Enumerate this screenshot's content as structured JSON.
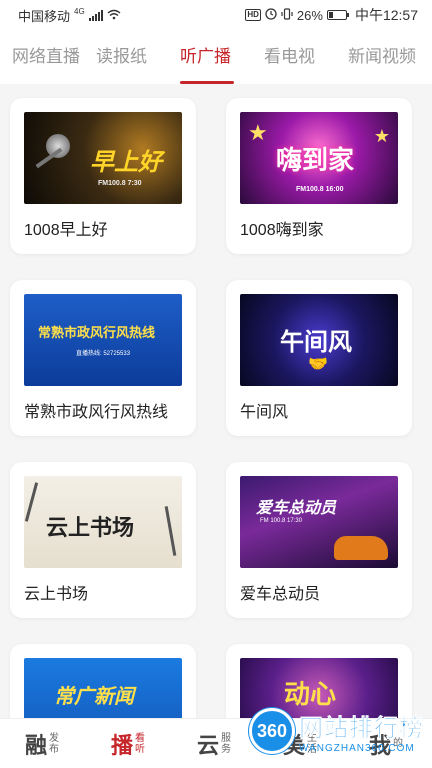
{
  "status_bar": {
    "carrier": "中国移动",
    "network": "4G",
    "hd": "HD",
    "battery": "26%",
    "battery_level": 0.26,
    "time": "中午12:57"
  },
  "tabs": [
    {
      "label": "网络直播",
      "active": false
    },
    {
      "label": "读报纸",
      "active": false
    },
    {
      "label": "听广播",
      "active": true
    },
    {
      "label": "看电视",
      "active": false
    },
    {
      "label": "新闻视频",
      "active": false
    }
  ],
  "cards": [
    {
      "title": "1008早上好",
      "thumb_text": "早上好",
      "thumb_sub": "FM100.8  7:30"
    },
    {
      "title": "1008嗨到家",
      "thumb_text": "嗨到家",
      "thumb_sub": "FM100.8  16:00"
    },
    {
      "title": "常熟市政风行风热线",
      "thumb_text": "常熟市政风行风热线",
      "thumb_sub": "直播热线: 52725533"
    },
    {
      "title": "午间风",
      "thumb_text": "午间风",
      "thumb_sub": ""
    },
    {
      "title": "云上书场",
      "thumb_text": "云上书场",
      "thumb_sub": ""
    },
    {
      "title": "爱车总动员",
      "thumb_text": "爱车总动员",
      "thumb_sub": "FM 100.8  17:30"
    },
    {
      "title": "",
      "thumb_text": "常广新闻",
      "thumb_sub": ""
    },
    {
      "title": "",
      "thumb_text": "动心",
      "thumb_sub": ""
    }
  ],
  "bottom_nav": [
    {
      "main": "融",
      "sub": "发布",
      "active": false
    },
    {
      "main": "播",
      "sub": "看听",
      "active": true
    },
    {
      "main": "云",
      "sub": "服务",
      "active": false
    },
    {
      "main": "美",
      "sub": "生活",
      "active": false
    },
    {
      "main": "我",
      "sub": "的",
      "active": false
    }
  ],
  "watermark": {
    "logo": "360",
    "title": "网站排行榜",
    "url": "WANGZHAN360.COM"
  },
  "colors": {
    "accent": "#c6262b",
    "tab_inactive": "#999999",
    "watermark_blue": "#1a8fe8"
  }
}
